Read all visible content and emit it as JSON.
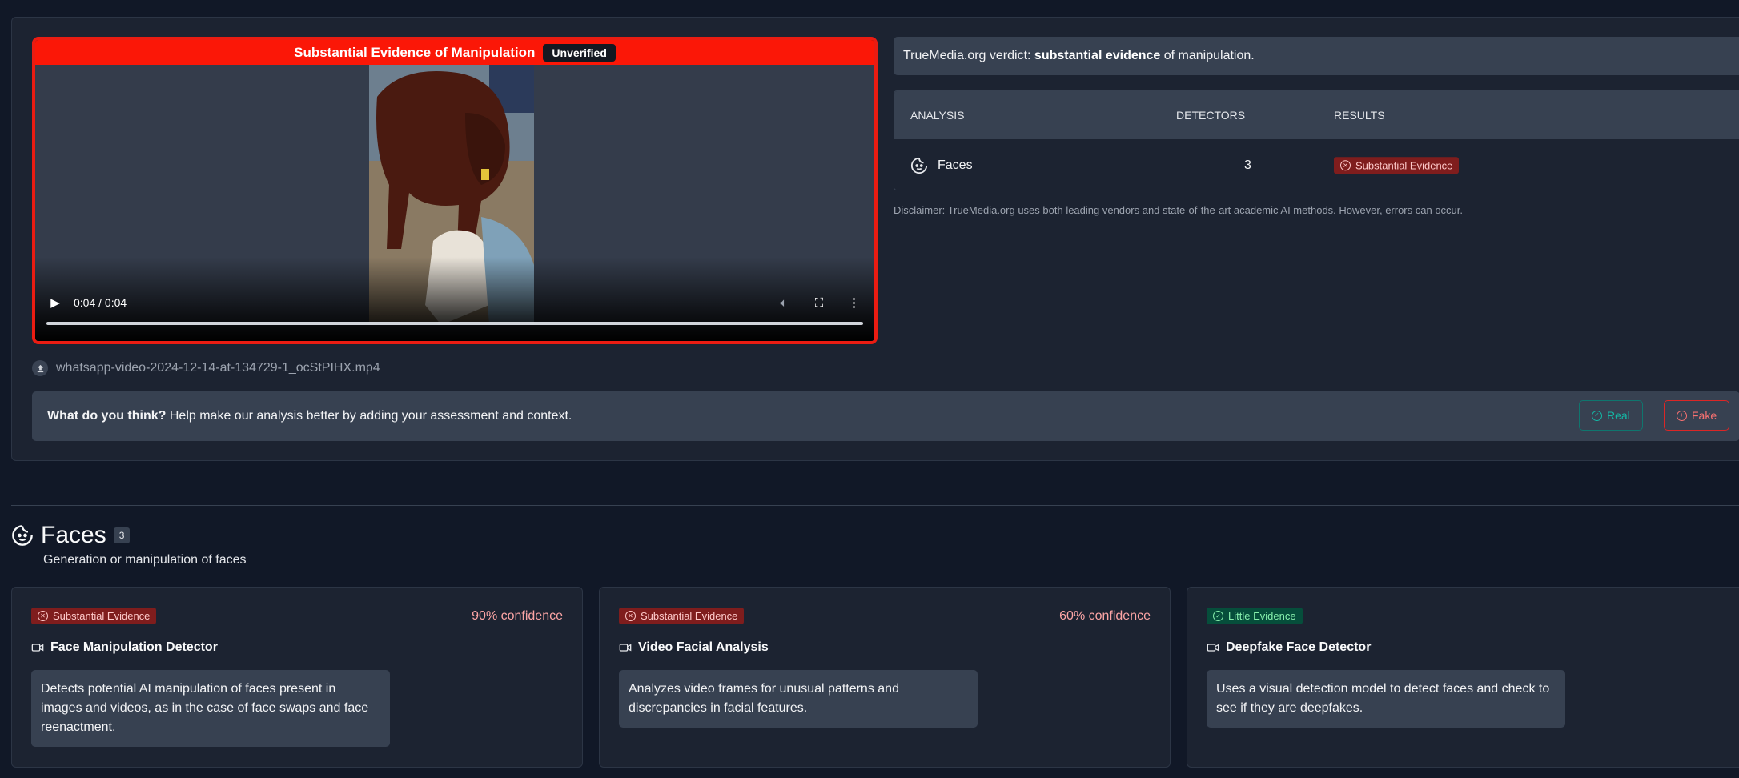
{
  "video": {
    "banner_text": "Substantial Evidence of Manipulation",
    "banner_tag": "Unverified",
    "time": "0:04 / 0:04",
    "progress": 1.0
  },
  "file": {
    "name": "whatsapp-video-2024-12-14-at-134729-1_ocStPIHX.mp4"
  },
  "feedback": {
    "question": "What do you think?",
    "prompt": " Help make our analysis better by adding your assessment and context.",
    "real_label": "Real",
    "fake_label": "Fake"
  },
  "verdict": {
    "prefix": "TrueMedia.org verdict: ",
    "strong": "substantial evidence",
    "suffix": " of manipulation."
  },
  "analysis_table": {
    "headers": {
      "analysis": "ANALYSIS",
      "detectors": "DETECTORS",
      "results": "RESULTS"
    },
    "rows": [
      {
        "name": "Faces",
        "detectors": "3",
        "result": "Substantial Evidence"
      }
    ]
  },
  "disclaimer": "Disclaimer: TrueMedia.org uses both leading vendors and state-of-the-art academic AI methods. However, errors can occur.",
  "faces_section": {
    "title": "Faces",
    "count": "3",
    "subtitle": "Generation or manipulation of faces"
  },
  "cards": [
    {
      "badge": "Substantial Evidence",
      "confidence": "90% confidence",
      "title": "Face Manipulation Detector",
      "description": "Detects potential AI manipulation of faces present in images and videos, as in the case of face swaps and face reenactment."
    },
    {
      "badge": "Substantial Evidence",
      "confidence": "60% confidence",
      "title": "Video Facial Analysis",
      "description": "Analyzes video frames for unusual patterns and discrepancies in facial features."
    },
    {
      "badge": "Little Evidence",
      "confidence": "",
      "title": "Deepfake Face Detector",
      "description": "Uses a visual detection model to detect faces and check to see if they are deepfakes."
    }
  ],
  "colors": {
    "background": "#111827",
    "manipulation_red": "#fb1707",
    "badge_red": "#7f1d1d",
    "badge_green": "#064e3b",
    "real_teal": "#14b8a6",
    "fake_red": "#f87171"
  }
}
